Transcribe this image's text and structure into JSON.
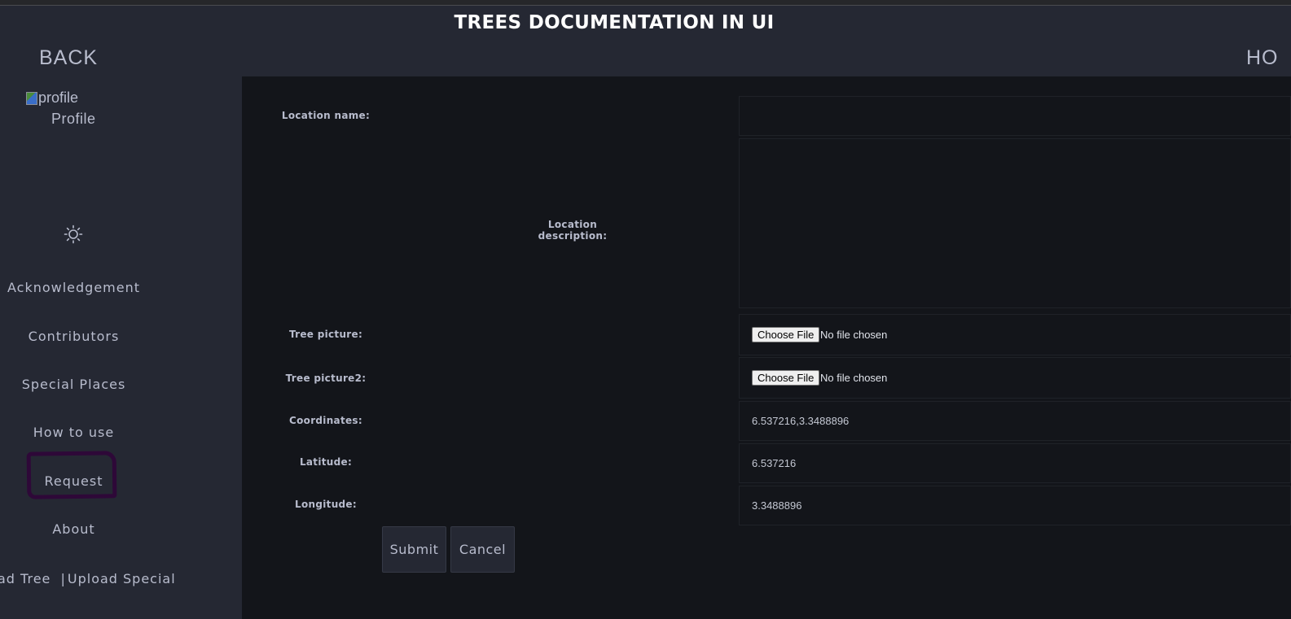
{
  "header": {
    "title": "TREES DOCUMENTATION IN UI",
    "back_label": "BACK",
    "home_label": "HO"
  },
  "sidebar": {
    "profile_img_alt": "profile",
    "profile_label": "Profile",
    "theme_icon": "sun-icon",
    "items": [
      {
        "label": "Acknowledgement"
      },
      {
        "label": "Contributors"
      },
      {
        "label": "Special Places"
      },
      {
        "label": "How to use"
      },
      {
        "label": "Request"
      },
      {
        "label": "About"
      }
    ],
    "upload_tree": "ad Tree",
    "upload_separator": "|",
    "upload_special": "Upload Special"
  },
  "form": {
    "location_name_label": "Location name:",
    "location_name_value": "",
    "location_description_label": "Location description:",
    "location_description_value": "",
    "tree_picture_label": "Tree picture:",
    "tree_picture2_label": "Tree picture2:",
    "choose_file_label": "Choose File",
    "no_file_text": "No file chosen",
    "coordinates_label": "Coordinates:",
    "coordinates_value": "6.537216,3.3488896",
    "latitude_label": "Latitude:",
    "latitude_value": "6.537216",
    "longitude_label": "Longitude:",
    "longitude_value": "3.3488896",
    "submit_label": "Submit",
    "cancel_label": "Cancel"
  },
  "colors": {
    "page_bg": "#13151a",
    "panel_bg": "#252833",
    "text": "#b8bccd",
    "title": "#ffffff",
    "request_highlight": "#2e0838"
  }
}
